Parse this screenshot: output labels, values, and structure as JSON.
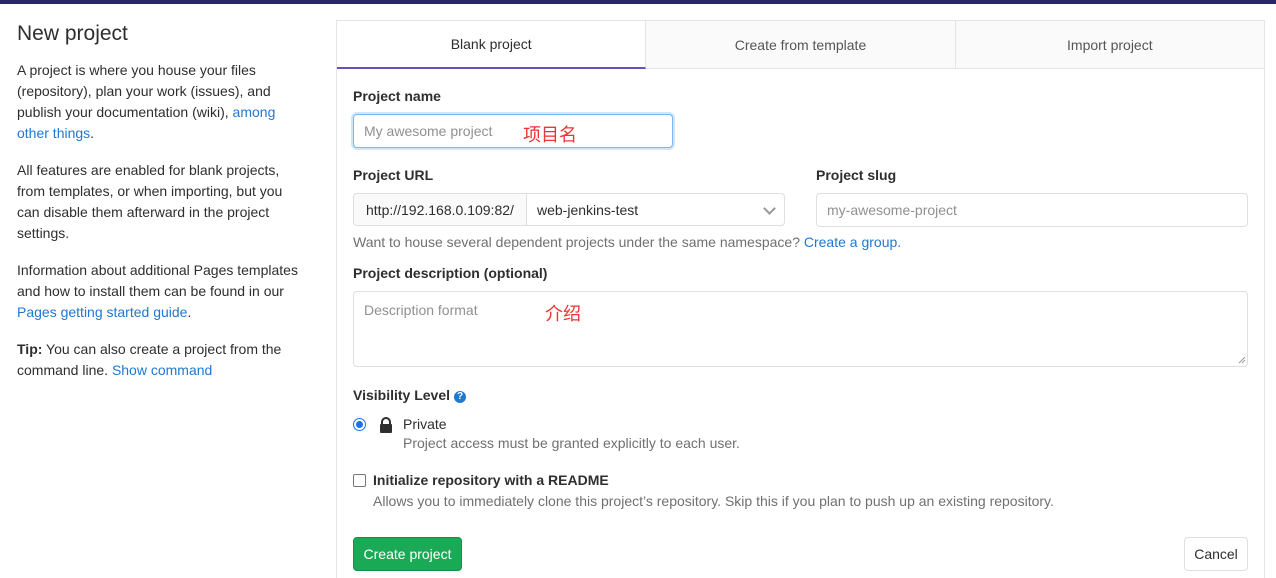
{
  "sidebar": {
    "title": "New project",
    "p1_text": "A project is where you house your files (repository), plan your work (issues), and publish your documentation (wiki), ",
    "p1_link": "among other things",
    "p1_end": ".",
    "p2_text": "All features are enabled for blank projects, from templates, or when importing, but you can disable them afterward in the project settings.",
    "p3_text": "Information about additional Pages templates and how to install them can be found in our ",
    "p3_link": "Pages getting started guide",
    "p3_end": ".",
    "tip_label": "Tip:",
    "tip_text": " You can also create a project from the command line. ",
    "tip_link": "Show command"
  },
  "tabs": [
    {
      "label": "Blank project",
      "active": true
    },
    {
      "label": "Create from template",
      "active": false
    },
    {
      "label": "Import project",
      "active": false
    }
  ],
  "form": {
    "project_name_label": "Project name",
    "project_name_placeholder": "My awesome project",
    "project_name_annotation": "项目名",
    "project_url_label": "Project URL",
    "url_prefix": "http://192.168.0.109:82/",
    "namespace_value": "web-jenkins-test",
    "project_slug_label": "Project slug",
    "project_slug_placeholder": "my-awesome-project",
    "namespace_help": "Want to house several dependent projects under the same namespace? ",
    "namespace_help_link": "Create a group.",
    "description_label": "Project description (optional)",
    "description_placeholder": "Description format",
    "description_annotation": "介绍",
    "visibility_label": "Visibility Level",
    "visibility_option_label": "Private",
    "visibility_option_desc": "Project access must be granted explicitly to each user.",
    "readme_label": "Initialize repository with a README",
    "readme_desc": "Allows you to immediately clone this project’s repository. Skip this if you plan to push up an existing repository.",
    "create_button": "Create project",
    "cancel_button": "Cancel"
  },
  "colors": {
    "accent": "#1aaa55",
    "link": "#1f78d1",
    "tab_active_border": "#6b4fbb",
    "annotation": "#ee3333"
  },
  "icons": {
    "visibility_help": "question-circle-icon",
    "private": "lock-icon",
    "namespace_select": "chevron-down-icon"
  }
}
